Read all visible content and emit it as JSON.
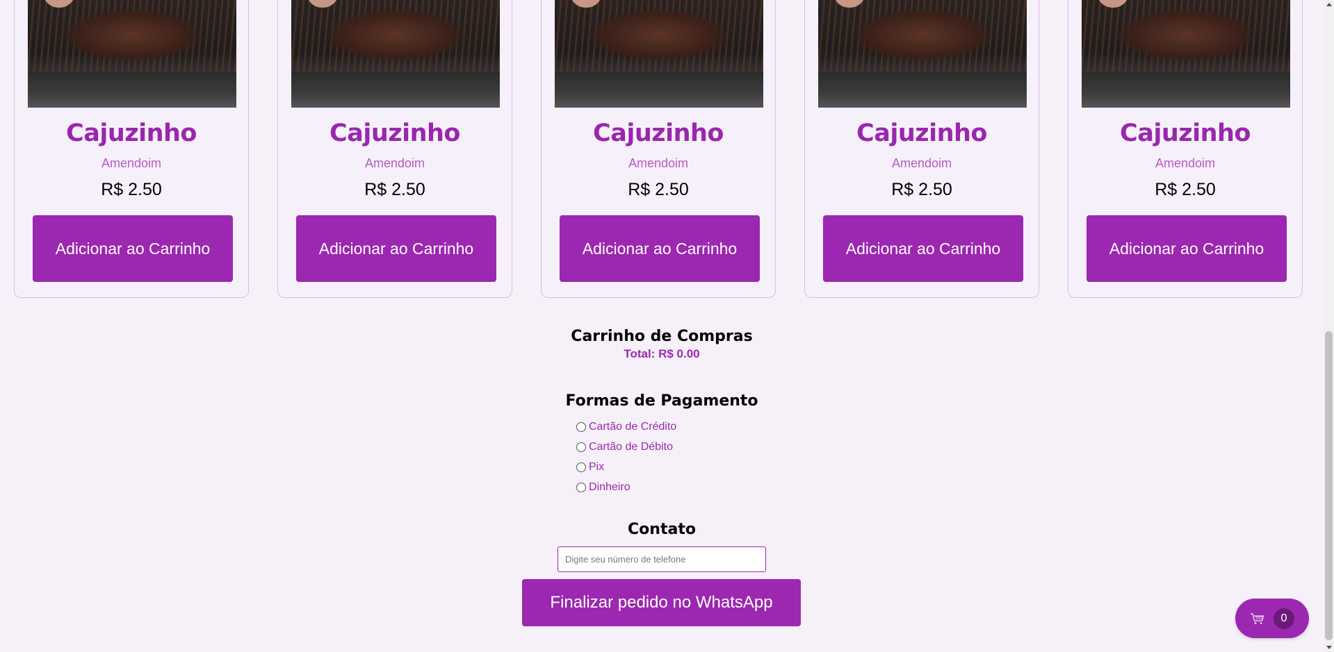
{
  "products": [
    {
      "name": "Cajuzinho",
      "flavor": "Amendoim",
      "price": "R$ 2.50",
      "button_label": "Adicionar ao Carrinho"
    },
    {
      "name": "Cajuzinho",
      "flavor": "Amendoim",
      "price": "R$ 2.50",
      "button_label": "Adicionar ao Carrinho"
    },
    {
      "name": "Cajuzinho",
      "flavor": "Amendoim",
      "price": "R$ 2.50",
      "button_label": "Adicionar ao Carrinho"
    },
    {
      "name": "Cajuzinho",
      "flavor": "Amendoim",
      "price": "R$ 2.50",
      "button_label": "Adicionar ao Carrinho"
    },
    {
      "name": "Cajuzinho",
      "flavor": "Amendoim",
      "price": "R$ 2.50",
      "button_label": "Adicionar ao Carrinho"
    }
  ],
  "cart": {
    "title": "Carrinho de Compras",
    "total": "Total: R$ 0.00"
  },
  "payment": {
    "title": "Formas de Pagamento",
    "options": [
      "Cartão de Crédito",
      "Cartão de Débito",
      "Pix",
      "Dinheiro"
    ]
  },
  "contact": {
    "title": "Contato",
    "phone_value": "",
    "phone_placeholder": "Digite seu número de telefone",
    "submit_label": "Finalizar pedido no WhatsApp"
  },
  "floating_cart": {
    "icon": "cart-icon",
    "count": "0"
  },
  "colors": {
    "accent": "#9c27b0",
    "background": "#f6f1f9",
    "card_border": "#e2b7ea"
  }
}
